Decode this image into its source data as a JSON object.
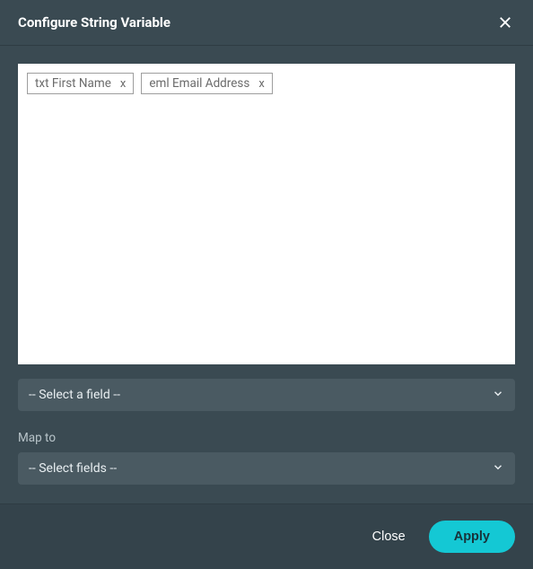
{
  "header": {
    "title": "Configure String Variable"
  },
  "chips": [
    {
      "label": "txt First Name"
    },
    {
      "label": "eml Email Address"
    }
  ],
  "selects": {
    "field_placeholder": "-- Select a field --",
    "map_to_label": "Map to",
    "map_to_placeholder": "-- Select fields --"
  },
  "footer": {
    "close": "Close",
    "apply": "Apply"
  }
}
